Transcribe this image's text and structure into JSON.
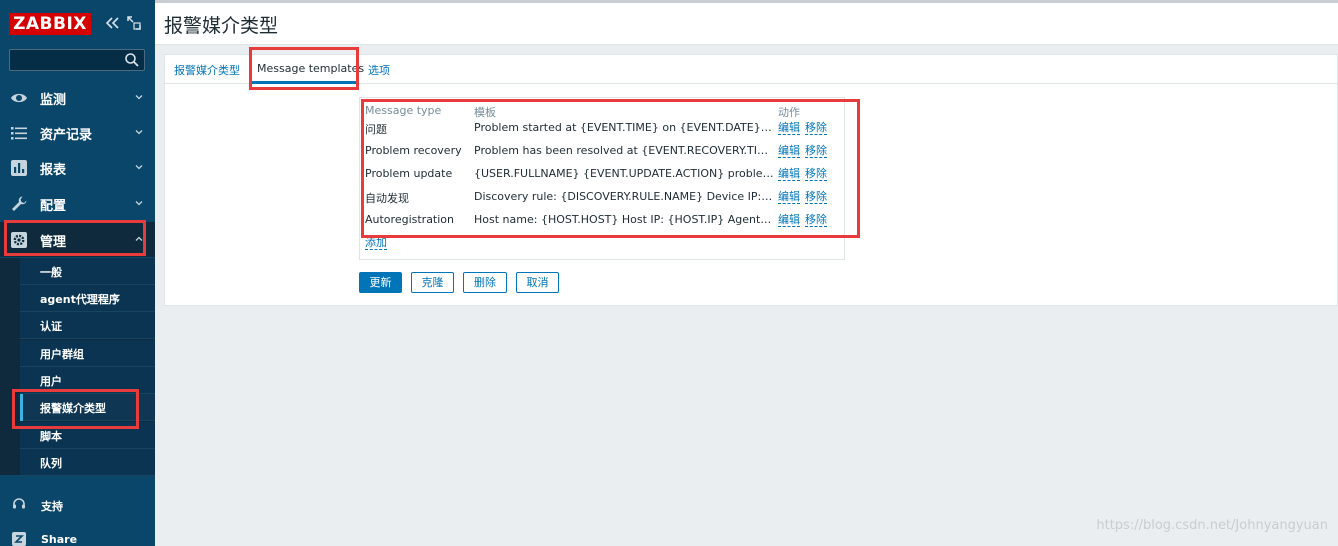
{
  "brand": {
    "logo_text": "ZABBIX",
    "logo_color": "#d40000",
    "sidebar_color": "#0a466a"
  },
  "search": {
    "value": "",
    "placeholder": ""
  },
  "sidebar": {
    "menu": [
      {
        "label": "监测",
        "icon": "eye-icon"
      },
      {
        "label": "资产记录",
        "icon": "list-icon"
      },
      {
        "label": "报表",
        "icon": "bar-chart-icon"
      },
      {
        "label": "配置",
        "icon": "wrench-icon"
      },
      {
        "label": "管理",
        "icon": "gear-icon"
      }
    ],
    "admin_items": [
      "一般",
      "agent代理程序",
      "认证",
      "用户群组",
      "用户",
      "报警媒介类型",
      "脚本",
      "队列"
    ],
    "bottom": [
      {
        "label": "支持",
        "icon": "headset-icon"
      },
      {
        "label": "Share",
        "icon": "share-z-icon"
      }
    ]
  },
  "header": {
    "title": "报警媒介类型"
  },
  "tabs": [
    {
      "label": "报警媒介类型"
    },
    {
      "label": "Message templates"
    },
    {
      "label": "选项"
    }
  ],
  "templates": {
    "headers": [
      "Message type",
      "模板",
      "动作"
    ],
    "rows": [
      {
        "type": "问题",
        "template": "Problem started at {EVENT.TIME} on {EVENT.DATE} Proble…",
        "edit": "编辑",
        "remove": "移除"
      },
      {
        "type": "Problem recovery",
        "template": "Problem has been resolved at {EVENT.RECOVERY.TIME} o…",
        "edit": "编辑",
        "remove": "移除"
      },
      {
        "type": "Problem update",
        "template": "{USER.FULLNAME} {EVENT.UPDATE.ACTION} problem at…",
        "edit": "编辑",
        "remove": "移除"
      },
      {
        "type": "自动发现",
        "template": "Discovery rule: {DISCOVERY.RULE.NAME} Device IP: {DIS…",
        "edit": "编辑",
        "remove": "移除"
      },
      {
        "type": "Autoregistration",
        "template": "Host name: {HOST.HOST} Host IP: {HOST.IP} Agent port: {…",
        "edit": "编辑",
        "remove": "移除"
      }
    ],
    "add_label": "添加"
  },
  "buttons": {
    "update": "更新",
    "clone": "克隆",
    "delete": "删除",
    "cancel": "取消"
  },
  "watermark": "https://blog.csdn.net/Johnyangyuan"
}
